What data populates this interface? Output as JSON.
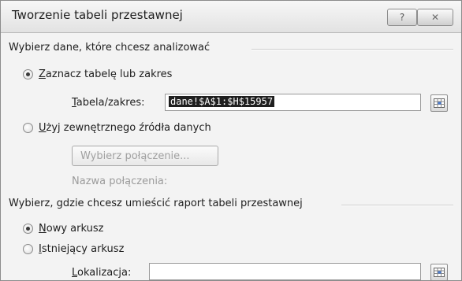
{
  "dialog": {
    "title": "Tworzenie tabeli przestawnej",
    "help_label": "?",
    "close_label": "✕"
  },
  "section_data": {
    "heading": "Wybierz dane, które chcesz analizować",
    "option_range": {
      "accesskey": "Z",
      "rest": "aznacz tabelę lub zakres",
      "checked": true
    },
    "range_field": {
      "label_accesskey": "T",
      "label_rest": "abela/zakres:",
      "value": "dane!$A$1:$H$15957"
    },
    "option_external": {
      "accesskey": "U",
      "rest": "żyj zewnętrznego źródła danych",
      "checked": false
    },
    "choose_connection_label": "Wybierz połączenie...",
    "connection_name_label": "Nazwa połączenia:"
  },
  "section_location": {
    "heading": "Wybierz, gdzie chcesz umieścić raport tabeli przestawnej",
    "option_new": {
      "accesskey": "N",
      "rest": "owy arkusz",
      "checked": true
    },
    "option_existing": {
      "accesskey": "I",
      "rest": "stniejący arkusz",
      "checked": false
    },
    "location_field": {
      "label_accesskey": "L",
      "label_rest": "okalizacja:",
      "value": ""
    }
  },
  "icons": {
    "help": "question-icon",
    "close": "close-icon",
    "range_picker": "collapse-dialog-icon"
  }
}
